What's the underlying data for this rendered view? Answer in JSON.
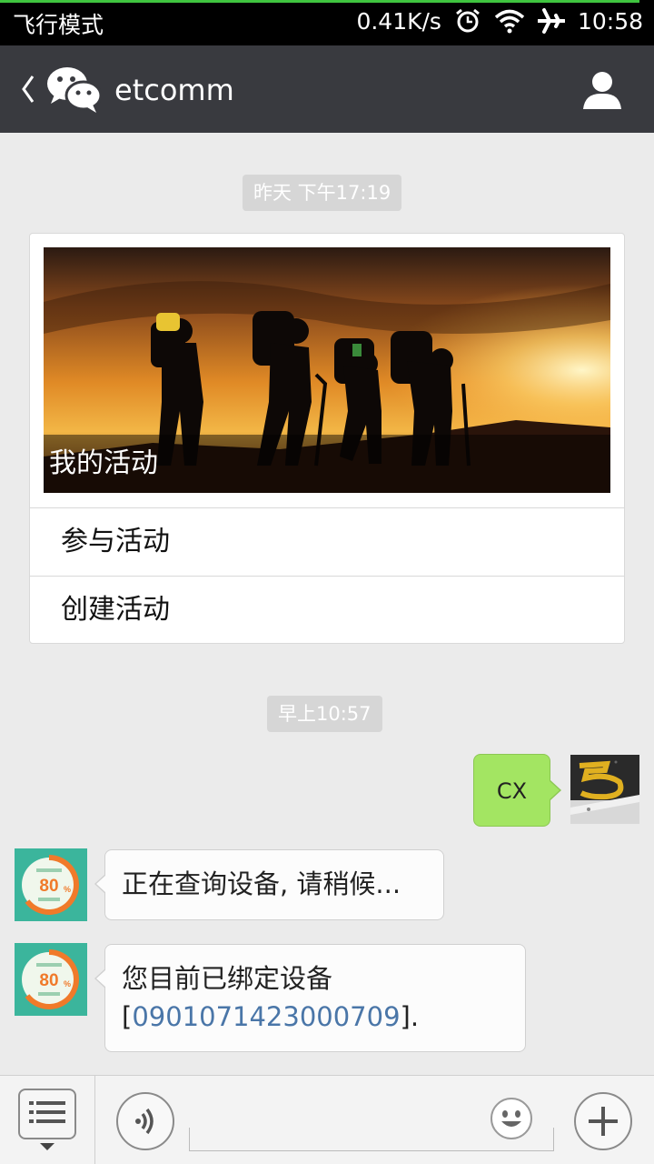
{
  "status_bar": {
    "mode_text": "飞行模式",
    "speed": "0.41K/s",
    "time": "10:58",
    "icons": [
      "alarm-icon",
      "wifi-icon",
      "airplane-icon"
    ]
  },
  "header": {
    "back_icon": "chevron-left-icon",
    "logo_icon": "wechat-logo-icon",
    "title": "etcomm",
    "profile_icon": "person-icon",
    "background_color": "#393a3f"
  },
  "messages": {
    "timestamp_1": "昨天 下午17:19",
    "card": {
      "banner_caption": "我的活动",
      "menu_items": [
        {
          "label": "参与活动"
        },
        {
          "label": "创建活动"
        }
      ]
    },
    "timestamp_2": "早上10:57",
    "sent_1": "CX",
    "received_1": "正在查询设备, 请稍候...",
    "received_2_line1": "您目前已绑定设备",
    "received_2_open": "[",
    "received_2_device": "0901071423000709",
    "received_2_close": "]."
  },
  "bot_avatar": {
    "percent": "80",
    "percent_unit": "%"
  },
  "input_bar": {
    "menu_icon": "menu-list-icon",
    "voice_icon": "voice-icon",
    "emoji_icon": "emoji-icon",
    "add_icon": "plus-icon",
    "text_value": ""
  },
  "colors": {
    "sent_bubble": "#a3e562",
    "link": "#4a76a8",
    "chat_background": "#ebebeb"
  }
}
